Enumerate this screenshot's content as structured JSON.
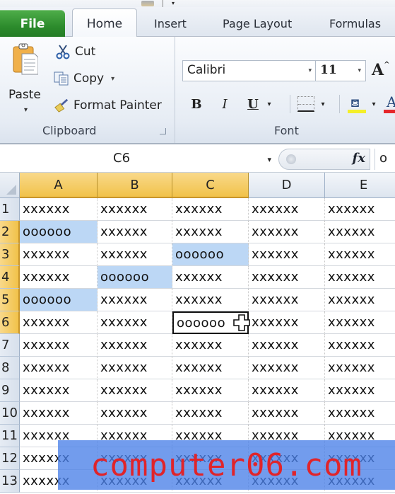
{
  "quick_access": {
    "dropdown_glyph": "▾"
  },
  "tabs": [
    {
      "label": "File",
      "active": false
    },
    {
      "label": "Home",
      "active": true
    },
    {
      "label": "Insert",
      "active": false
    },
    {
      "label": "Page Layout",
      "active": false
    },
    {
      "label": "Formulas",
      "active": false
    }
  ],
  "ribbon": {
    "clipboard": {
      "group_label": "Clipboard",
      "paste_label": "Paste",
      "paste_caret": "▾",
      "cut_label": "Cut",
      "copy_label": "Copy",
      "copy_caret": "▾",
      "format_painter_label": "Format Painter"
    },
    "font": {
      "group_label": "Font",
      "font_name": "Calibri",
      "font_size": "11",
      "dropdown_glyph": "▾",
      "grow_font_glyph": "A",
      "grow_font_sup": "^",
      "bold_glyph": "B",
      "italic_glyph": "I",
      "underline_glyph": "U",
      "fill_color": "#f4ef2a",
      "font_color": "#e5262a"
    }
  },
  "formula_bar": {
    "name_box": "C6",
    "name_box_caret": "▾",
    "fx_label": "fx",
    "content": "o"
  },
  "sheet": {
    "columns": [
      "A",
      "B",
      "C",
      "D",
      "E"
    ],
    "selected_columns": [
      "A",
      "B",
      "C"
    ],
    "rows": [
      "1",
      "2",
      "3",
      "4",
      "5",
      "6",
      "7",
      "8",
      "9",
      "10",
      "11",
      "12",
      "13"
    ],
    "selected_rows": [
      "2",
      "3",
      "4",
      "5",
      "6"
    ],
    "active_cell": "C6",
    "highlight_color": "#bcd7f5",
    "cells": [
      [
        "xxxxxx",
        "xxxxxx",
        "xxxxxx",
        "xxxxxx",
        "xxxxxx"
      ],
      [
        "oooooo",
        "xxxxxx",
        "xxxxxx",
        "xxxxxx",
        "xxxxxx"
      ],
      [
        "xxxxxx",
        "xxxxxx",
        "oooooo",
        "xxxxxx",
        "xxxxxx"
      ],
      [
        "xxxxxx",
        "oooooo",
        "xxxxxx",
        "xxxxxx",
        "xxxxxx"
      ],
      [
        "oooooo",
        "xxxxxx",
        "xxxxxx",
        "xxxxxx",
        "xxxxxx"
      ],
      [
        "xxxxxx",
        "xxxxxx",
        "oooooo",
        "xxxxxx",
        "xxxxxx"
      ],
      [
        "xxxxxx",
        "xxxxxx",
        "xxxxxx",
        "xxxxxx",
        "xxxxxx"
      ],
      [
        "xxxxxx",
        "xxxxxx",
        "xxxxxx",
        "xxxxxx",
        "xxxxxx"
      ],
      [
        "xxxxxx",
        "xxxxxx",
        "xxxxxx",
        "xxxxxx",
        "xxxxxx"
      ],
      [
        "xxxxxx",
        "xxxxxx",
        "xxxxxx",
        "xxxxxx",
        "xxxxxx"
      ],
      [
        "xxxxxx",
        "xxxxxx",
        "xxxxxx",
        "xxxxxx",
        "xxxxxx"
      ],
      [
        "xxxxxx",
        "xxxxxx",
        "xxxxxx",
        "xxxxxx",
        "xxxxxx"
      ],
      [
        "xxxxxx",
        "xxxxxx",
        "xxxxxx",
        "xxxxxx",
        "xxxxxx"
      ]
    ],
    "highlighted_cells": [
      "A2",
      "C3",
      "B4",
      "A5"
    ]
  },
  "watermark": {
    "text": "computer06.com"
  }
}
